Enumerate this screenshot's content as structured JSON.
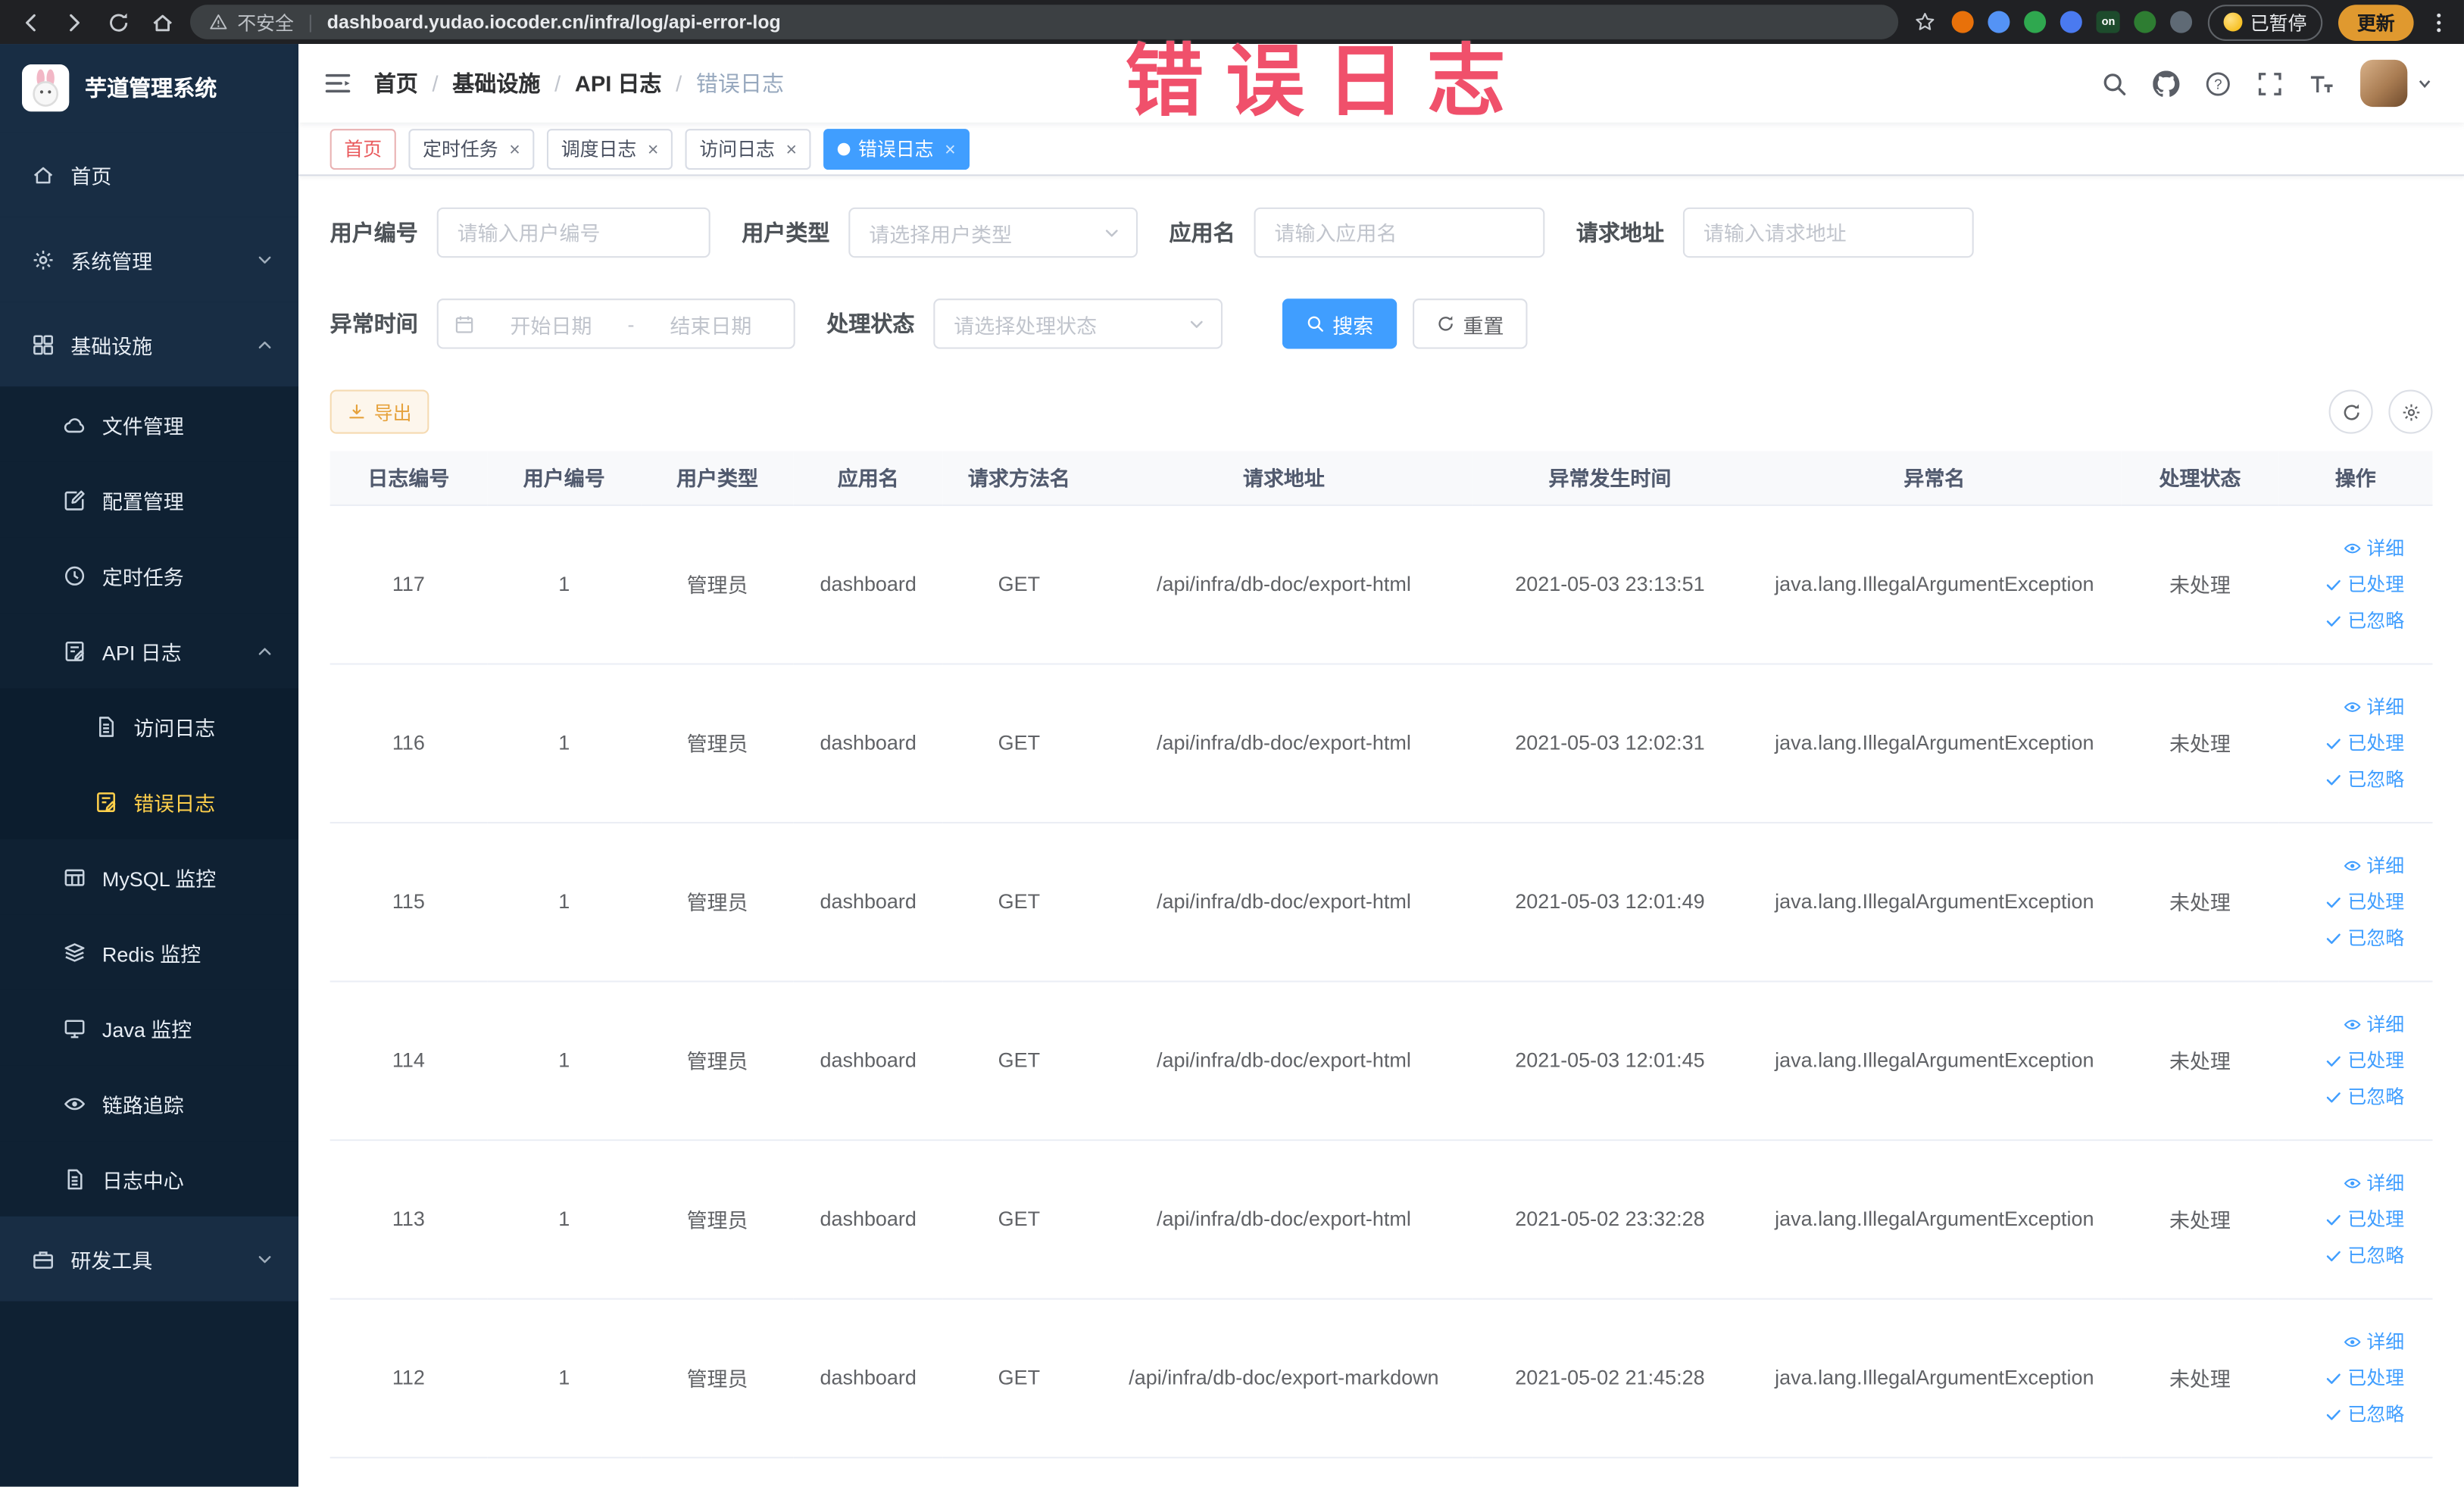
{
  "colors": {
    "accent_blue": "#409eff",
    "menu_active_yellow": "#ffd04b",
    "warning_orange": "#e6a23c",
    "annotation_red": "#f0506b"
  },
  "annotation": {
    "text": "错误日志"
  },
  "browser": {
    "security_label": "不安全",
    "url": "dashboard.yudao.iocoder.cn/infra/log/api-error-log",
    "paused_label": "已暂停",
    "update_label": "更新",
    "extensions": [
      {
        "name": "extension-orange",
        "color": "#e8710a",
        "label": ""
      },
      {
        "name": "extension-blue",
        "color": "#5493f5",
        "label": ""
      },
      {
        "name": "extension-green",
        "color": "#2fa84f",
        "label": ""
      },
      {
        "name": "extension-grid",
        "color": "#4a7af0",
        "label": ""
      },
      {
        "name": "extension-switch",
        "color": "#1d4b2c",
        "label": "on"
      },
      {
        "name": "extension-leaf",
        "color": "#2e7d32",
        "label": ""
      },
      {
        "name": "extension-paw",
        "color": "#5f6a75",
        "label": ""
      }
    ]
  },
  "sidebar": {
    "logo_title": "芋道管理系统",
    "menu": [
      {
        "id": "home",
        "label": "首页",
        "icon": "home-icon",
        "level": 0
      },
      {
        "id": "system",
        "label": "系统管理",
        "icon": "gear-icon",
        "level": 0,
        "arrow": "down"
      },
      {
        "id": "infra",
        "label": "基础设施",
        "icon": "infra-icon",
        "level": 0,
        "arrow": "up"
      },
      {
        "id": "file",
        "label": "文件管理",
        "icon": "file-icon",
        "level": 1
      },
      {
        "id": "config",
        "label": "配置管理",
        "icon": "config-icon",
        "level": 1
      },
      {
        "id": "job",
        "label": "定时任务",
        "icon": "job-icon",
        "level": 1
      },
      {
        "id": "api-log",
        "label": "API 日志",
        "icon": "api-log-icon",
        "level": 1,
        "arrow": "up"
      },
      {
        "id": "access-log",
        "label": "访问日志",
        "icon": "access-log-icon",
        "level": 2
      },
      {
        "id": "error-log",
        "label": "错误日志",
        "icon": "error-log-icon",
        "level": 2,
        "active": true
      },
      {
        "id": "mysql",
        "label": "MySQL 监控",
        "icon": "mysql-icon",
        "level": 1
      },
      {
        "id": "redis",
        "label": "Redis 监控",
        "icon": "redis-icon",
        "level": 1
      },
      {
        "id": "java",
        "label": "Java 监控",
        "icon": "java-icon",
        "level": 1
      },
      {
        "id": "trace",
        "label": "链路追踪",
        "icon": "trace-icon",
        "level": 1
      },
      {
        "id": "log-center",
        "label": "日志中心",
        "icon": "log-center-icon",
        "level": 1
      },
      {
        "id": "dev-tools",
        "label": "研发工具",
        "icon": "tools-icon",
        "level": 0,
        "arrow": "down"
      }
    ]
  },
  "header": {
    "breadcrumb": [
      "首页",
      "基础设施",
      "API 日志",
      "错误日志"
    ]
  },
  "tags": [
    {
      "id": "home",
      "label": "首页",
      "closable": false,
      "active": false,
      "affix": true
    },
    {
      "id": "job",
      "label": "定时任务",
      "closable": true,
      "active": false,
      "affix": false
    },
    {
      "id": "job-log",
      "label": "调度日志",
      "closable": true,
      "active": false,
      "affix": false
    },
    {
      "id": "access-log",
      "label": "访问日志",
      "closable": true,
      "active": false,
      "affix": false
    },
    {
      "id": "error-log",
      "label": "错误日志",
      "closable": true,
      "active": true,
      "affix": false
    }
  ],
  "filters": {
    "user_id_label": "用户编号",
    "user_id_placeholder": "请输入用户编号",
    "user_type_label": "用户类型",
    "user_type_placeholder": "请选择用户类型",
    "app_name_label": "应用名",
    "app_name_placeholder": "请输入应用名",
    "request_url_label": "请求地址",
    "request_url_placeholder": "请输入请求地址",
    "exception_time_label": "异常时间",
    "date_start_placeholder": "开始日期",
    "date_separator": "-",
    "date_end_placeholder": "结束日期",
    "process_status_label": "处理状态",
    "process_status_placeholder": "请选择处理状态",
    "search_label": "搜索",
    "reset_label": "重置"
  },
  "toolbar": {
    "export_label": "导出"
  },
  "table": {
    "columns": [
      "日志编号",
      "用户编号",
      "用户类型",
      "应用名",
      "请求方法名",
      "请求地址",
      "异常发生时间",
      "异常名",
      "处理状态",
      "操作"
    ],
    "action_labels": {
      "detail": "详细",
      "processed": "已处理",
      "ignored": "已忽略"
    },
    "rows": [
      {
        "log_id": "117",
        "user_id": "1",
        "user_type": "管理员",
        "app_name": "dashboard",
        "method": "GET",
        "request_url": "/api/infra/db-doc/export-html",
        "exception_time": "2021-05-03 23:13:51",
        "exception_name": "java.lang.IllegalArgumentException",
        "status": "未处理"
      },
      {
        "log_id": "116",
        "user_id": "1",
        "user_type": "管理员",
        "app_name": "dashboard",
        "method": "GET",
        "request_url": "/api/infra/db-doc/export-html",
        "exception_time": "2021-05-03 12:02:31",
        "exception_name": "java.lang.IllegalArgumentException",
        "status": "未处理"
      },
      {
        "log_id": "115",
        "user_id": "1",
        "user_type": "管理员",
        "app_name": "dashboard",
        "method": "GET",
        "request_url": "/api/infra/db-doc/export-html",
        "exception_time": "2021-05-03 12:01:49",
        "exception_name": "java.lang.IllegalArgumentException",
        "status": "未处理"
      },
      {
        "log_id": "114",
        "user_id": "1",
        "user_type": "管理员",
        "app_name": "dashboard",
        "method": "GET",
        "request_url": "/api/infra/db-doc/export-html",
        "exception_time": "2021-05-03 12:01:45",
        "exception_name": "java.lang.IllegalArgumentException",
        "status": "未处理"
      },
      {
        "log_id": "113",
        "user_id": "1",
        "user_type": "管理员",
        "app_name": "dashboard",
        "method": "GET",
        "request_url": "/api/infra/db-doc/export-html",
        "exception_time": "2021-05-02 23:32:28",
        "exception_name": "java.lang.IllegalArgumentException",
        "status": "未处理"
      },
      {
        "log_id": "112",
        "user_id": "1",
        "user_type": "管理员",
        "app_name": "dashboard",
        "method": "GET",
        "request_url": "/api/infra/db-doc/export-markdown",
        "exception_time": "2021-05-02 21:45:28",
        "exception_name": "java.lang.IllegalArgumentException",
        "status": "未处理"
      }
    ]
  }
}
